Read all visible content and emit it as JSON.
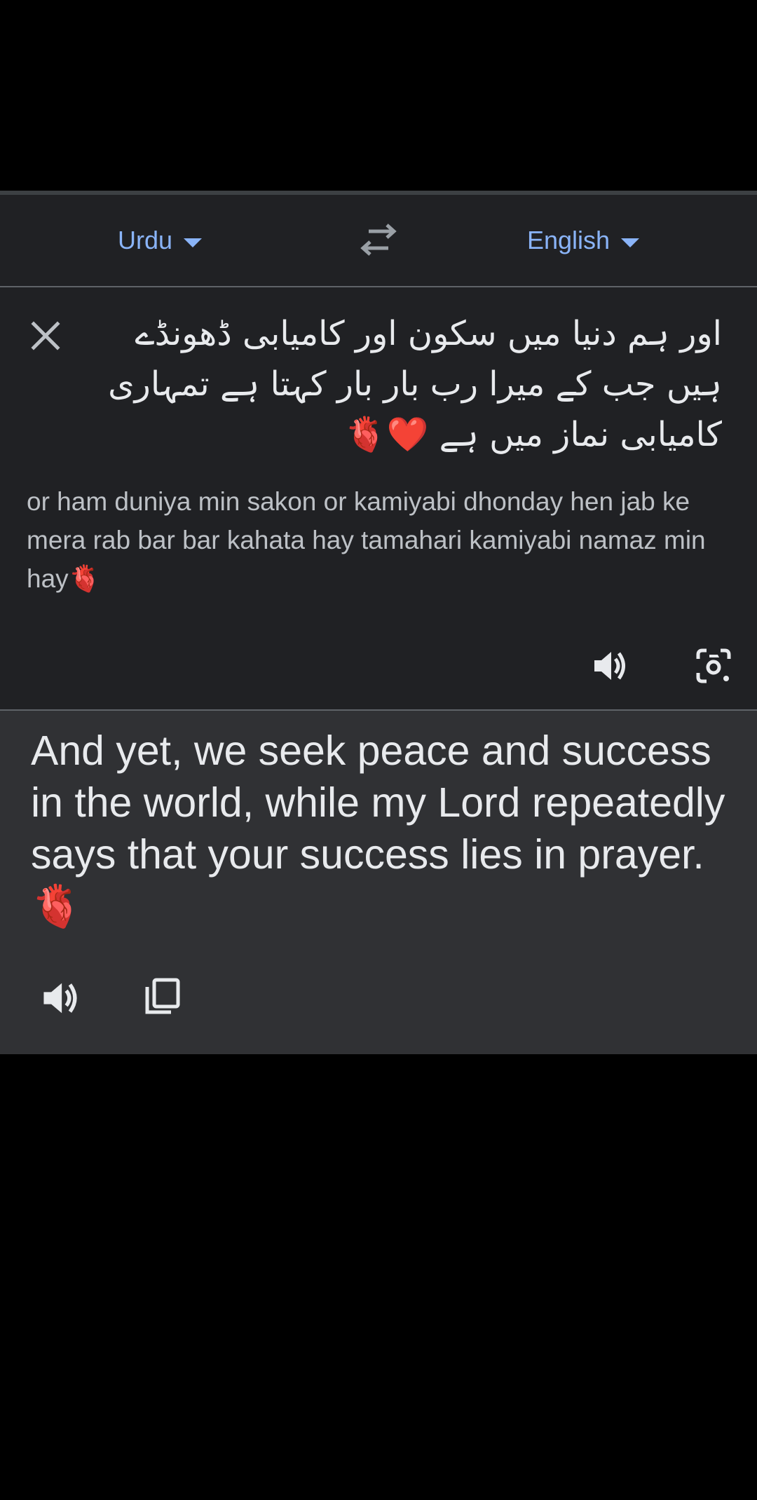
{
  "language_bar": {
    "source_language": "Urdu",
    "target_language": "English",
    "swap_icon": "swap-arrows-icon"
  },
  "source": {
    "text": "اور ہم دنیا میں سکون اور کامیابی ڈھونڈے ہیں جب کے میرا رب بار بار کہتا ہے تمہاری کامیابی نماز میں ہے ❤️‍",
    "heart_emoji": "🫀",
    "transliteration": "or ham duniya min sakon or kamiyabi dhonday hen jab ke mera rab bar bar kahata hay tamahari kamiyabi namaz min hay",
    "icons": [
      "close-icon",
      "speaker-icon",
      "camera-icon"
    ]
  },
  "result": {
    "text": "And yet, we seek peace and success in the world, while my Lord repeatedly says that your success lies in prayer. ",
    "heart_emoji": "🫀",
    "icons": [
      "speaker-icon",
      "copy-icon"
    ]
  },
  "colors": {
    "background": "#000000",
    "panel": "#202124",
    "result_panel": "#303134",
    "accent": "#8ab4f8",
    "text_primary": "#e8eaed",
    "text_secondary": "#bdc1c6",
    "divider": "#5f6368"
  }
}
